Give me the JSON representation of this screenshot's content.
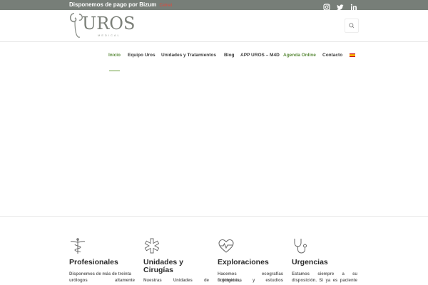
{
  "topbar": {
    "promo": "Disponemos de pago por Bizum",
    "badge": "Cetnet",
    "social_icons": [
      "instagram-icon",
      "twitter-icon",
      "linkedin-icon"
    ]
  },
  "header": {
    "logo_text": "UROS",
    "logo_sub": "MEDICAL",
    "search_icon": "search-icon"
  },
  "nav": {
    "items": [
      {
        "label": "Inicio"
      },
      {
        "label": "Equipo Uros"
      },
      {
        "label": "Unidades y Tratamientos"
      },
      {
        "label": "Blog"
      },
      {
        "label": "APP UROS – M4D"
      },
      {
        "label": "Agenda Online"
      },
      {
        "label": "Contacto"
      }
    ],
    "language_flag": "spain-flag-icon"
  },
  "features": [
    {
      "icon": "caduceus-icon",
      "title": "Profesionales",
      "text_lines": [
        "Disponemos de más de treinta",
        "urólogos altamente"
      ]
    },
    {
      "icon": "medical-star-icon",
      "title": "Unidades y Cirugías",
      "text_lines": [
        "Nuestras Unidades de"
      ]
    },
    {
      "icon": "heartbeat-icon",
      "title": "Exploraciones",
      "text_lines": [
        "Hacemos ecografías urológicas,",
        "flujometrías y estudios"
      ]
    },
    {
      "icon": "stethoscope-icon",
      "title": "Urgencias",
      "text_lines": [
        "Estamos siempre a su",
        "disposición. Si ya es paciente"
      ]
    }
  ],
  "colors": {
    "topbar": "#777e78",
    "accent_green": "#5a8a3a",
    "badge_red": "#e2473c"
  }
}
